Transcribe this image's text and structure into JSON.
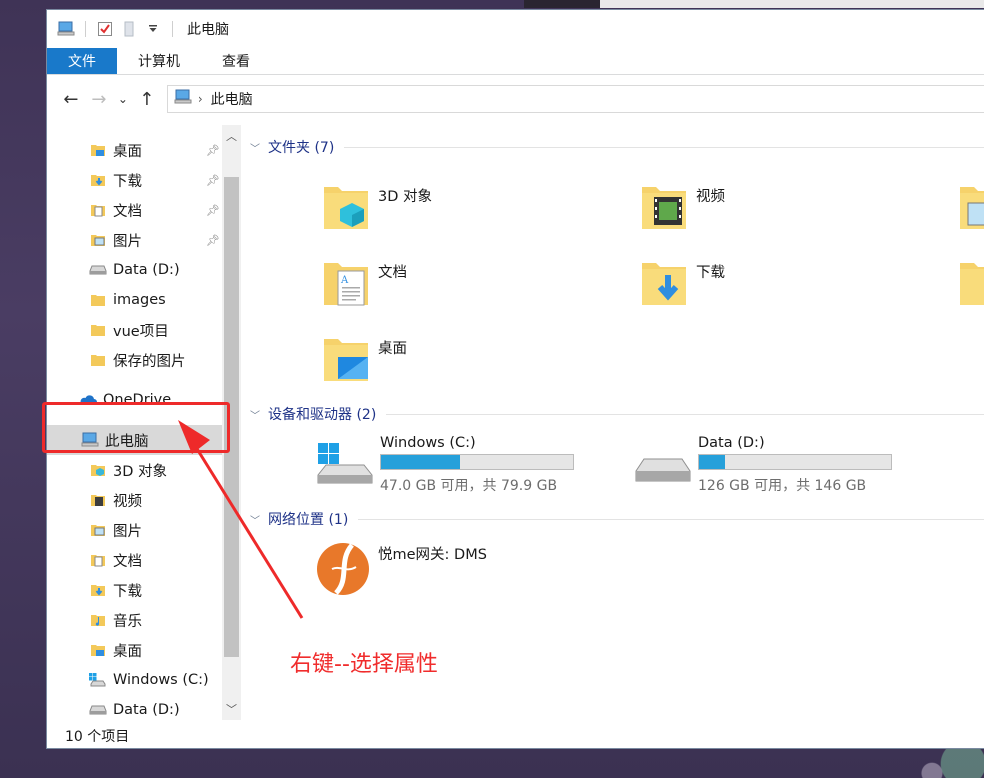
{
  "window": {
    "title": "此电脑"
  },
  "ribbon": {
    "tabs": [
      {
        "label": "文件",
        "active": true
      },
      {
        "label": "计算机",
        "active": false
      },
      {
        "label": "查看",
        "active": false
      }
    ]
  },
  "address": {
    "path": "此电脑"
  },
  "nav": {
    "items": [
      {
        "label": "桌面",
        "icon": "desktop-folder-icon",
        "pinned": true
      },
      {
        "label": "下载",
        "icon": "downloads-folder-icon",
        "pinned": true
      },
      {
        "label": "文档",
        "icon": "documents-folder-icon",
        "pinned": true
      },
      {
        "label": "图片",
        "icon": "pictures-folder-icon",
        "pinned": true
      },
      {
        "label": "Data (D:)",
        "icon": "drive-icon",
        "pinned": false
      },
      {
        "label": "images",
        "icon": "folder-icon",
        "pinned": false
      },
      {
        "label": "vue项目",
        "icon": "folder-icon",
        "pinned": false
      },
      {
        "label": "保存的图片",
        "icon": "folder-icon",
        "pinned": false
      },
      {
        "label": "OneDrive",
        "icon": "onedrive-cloud-icon",
        "pinned": false
      },
      {
        "label": "此电脑",
        "icon": "this-pc-icon",
        "pinned": false,
        "selected": true
      },
      {
        "label": "3D 对象",
        "icon": "3d-objects-icon",
        "pinned": false
      },
      {
        "label": "视频",
        "icon": "videos-folder-icon",
        "pinned": false
      },
      {
        "label": "图片",
        "icon": "pictures-folder-icon",
        "pinned": false
      },
      {
        "label": "文档",
        "icon": "documents-folder-icon",
        "pinned": false
      },
      {
        "label": "下载",
        "icon": "downloads-folder-icon",
        "pinned": false
      },
      {
        "label": "音乐",
        "icon": "music-folder-icon",
        "pinned": false
      },
      {
        "label": "桌面",
        "icon": "desktop-folder-icon",
        "pinned": false
      },
      {
        "label": "Windows (C:)",
        "icon": "windows-drive-icon",
        "pinned": false
      },
      {
        "label": "Data (D:)",
        "icon": "drive-icon",
        "pinned": false
      }
    ]
  },
  "content": {
    "folders_header": "文件夹 (7)",
    "folders": [
      {
        "label": "3D 对象",
        "icon": "3d-objects-icon"
      },
      {
        "label": "视频",
        "icon": "videos-folder-icon"
      },
      {
        "label": "文档",
        "icon": "documents-folder-icon"
      },
      {
        "label": "下载",
        "icon": "downloads-folder-icon"
      },
      {
        "label": "桌面",
        "icon": "desktop-folder-icon"
      }
    ],
    "drives_header": "设备和驱动器 (2)",
    "drives": [
      {
        "name": "Windows (C:)",
        "info": "47.0 GB 可用，共 79.9 GB",
        "free_gb": 47.0,
        "total_gb": 79.9,
        "icon": "windows-drive-icon"
      },
      {
        "name": "Data (D:)",
        "info": "126 GB 可用，共 146 GB",
        "free_gb": 126,
        "total_gb": 146,
        "icon": "drive-icon"
      }
    ],
    "network_header": "网络位置 (1)",
    "network": [
      {
        "label": "悦me网关: DMS",
        "icon": "network-media-server-icon"
      }
    ]
  },
  "status": {
    "item_count": "10 个项目"
  },
  "annotation": {
    "text": "右键--选择属性",
    "color": "#f02c2c"
  },
  "colors": {
    "accent": "#1979ca",
    "drive_fill": "#26a0da",
    "group_header": "#1e3287"
  }
}
